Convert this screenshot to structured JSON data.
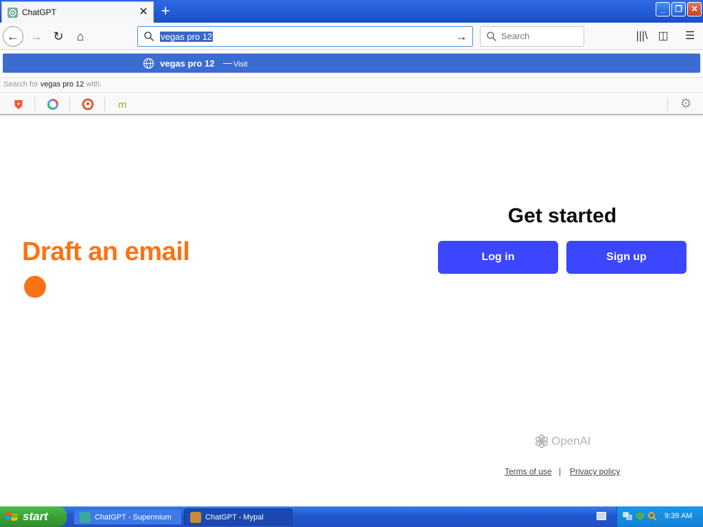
{
  "browser": {
    "tab": {
      "title": "ChatGPT",
      "favicon": "chatgpt-logo-icon"
    },
    "new_tab_icon": "plus-icon",
    "window_controls": [
      "minimize-icon",
      "restore-icon",
      "close-icon"
    ],
    "nav": {
      "back_icon": "back-arrow-icon",
      "forward_icon": "forward-arrow-icon",
      "reload_icon": "reload-icon",
      "home_icon": "home-icon"
    },
    "url_bar": {
      "value": "vegas pro 12",
      "go_icon": "go-arrow-icon"
    },
    "search_box": {
      "placeholder": "Search"
    },
    "toolbar_icons": [
      "library-icon",
      "sidebar-icon",
      "menu-icon"
    ],
    "suggestion": {
      "title": "vegas pro 12",
      "dash": "—",
      "action": "Visit"
    },
    "search_with": {
      "prefix": "Search for ",
      "query": "vegas pro 12",
      "suffix": " with:"
    },
    "engines": [
      "brave-icon",
      "qwant-icon",
      "duckduckgo-icon",
      "mojeek-icon"
    ],
    "accent": "#3b6dd0"
  },
  "page": {
    "hero_text": "Draft an email",
    "hero_color": "#f97316",
    "heading": "Get started",
    "login_label": "Log in",
    "signup_label": "Sign up",
    "button_color": "#3c46ff",
    "brand": "OpenAI",
    "footer": {
      "terms": "Terms of use",
      "separator": "|",
      "privacy": "Privacy policy"
    }
  },
  "taskbar": {
    "start_label": "start",
    "tasks": [
      {
        "label": "ChatGPT - Supermium",
        "active": false
      },
      {
        "label": "ChatGPT - Mypal",
        "active": true
      }
    ],
    "clock": "9:39 AM"
  }
}
